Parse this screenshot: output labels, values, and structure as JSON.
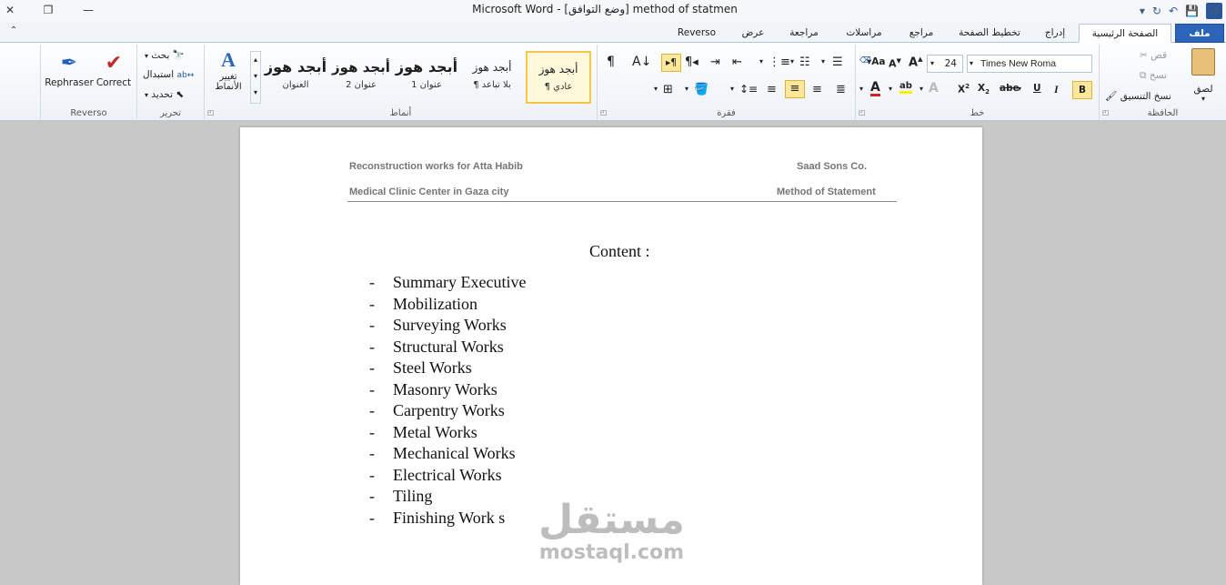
{
  "titlebar": {
    "title": "Microsoft Word  -  [وضع التوافق] method of statmen"
  },
  "tabs": [
    {
      "label": "ملف"
    },
    {
      "label": "الصفحة الرئيسية"
    },
    {
      "label": "إدراج"
    },
    {
      "label": "تخطيط الصفحة"
    },
    {
      "label": "مراجع"
    },
    {
      "label": "مراسلات"
    },
    {
      "label": "مراجعة"
    },
    {
      "label": "عرض"
    },
    {
      "label": "Reverso"
    }
  ],
  "ribbon": {
    "clipboard": {
      "label": "الحافظة",
      "paste": "لصق",
      "cut": "قص",
      "copy": "نسخ",
      "format_painter": "نسخ التنسيق"
    },
    "font": {
      "label": "خط",
      "font_name": "Times New Roma",
      "font_size": "24"
    },
    "paragraph": {
      "label": "فقرة"
    },
    "styles": {
      "label": "أنماط",
      "change_styles": "تغيير الأنماط",
      "items": [
        {
          "sample": "أبجد هوز",
          "name": "¶ عادي"
        },
        {
          "sample": "أبجد هوز",
          "name": "¶ بلا تباعد"
        },
        {
          "sample": "أبجد هوز",
          "name": "عنوان 1"
        },
        {
          "sample": "أبجد هوز",
          "name": "عنوان 2"
        },
        {
          "sample": "أبجد هوز",
          "name": "العنوان"
        }
      ]
    },
    "editing": {
      "label": "تحرير",
      "find": "بحث",
      "replace": "استبدال",
      "select": "تحديد"
    },
    "reverso": {
      "label": "Reverso",
      "rephraser": "Rephraser",
      "correct": "Correct"
    }
  },
  "document": {
    "header": {
      "left_top": "Reconstruction  works for Atta Habib",
      "left_bottom": "Medical  Clinic Center in Gaza city",
      "right_top": "Saad Sons Co.",
      "right_bottom": "Method of Statement"
    },
    "content_title": "Content :",
    "items": [
      "Summary Executive",
      "Mobilization",
      "Surveying Works",
      "Structural Works",
      "Steel Works",
      "Masonry Works",
      "Carpentry Works",
      "Metal Works",
      "Mechanical Works",
      "Electrical Works",
      "Tiling",
      "Finishing Work s"
    ]
  },
  "watermark": {
    "arabic": "مستقل",
    "latin": "mostaql.com"
  }
}
